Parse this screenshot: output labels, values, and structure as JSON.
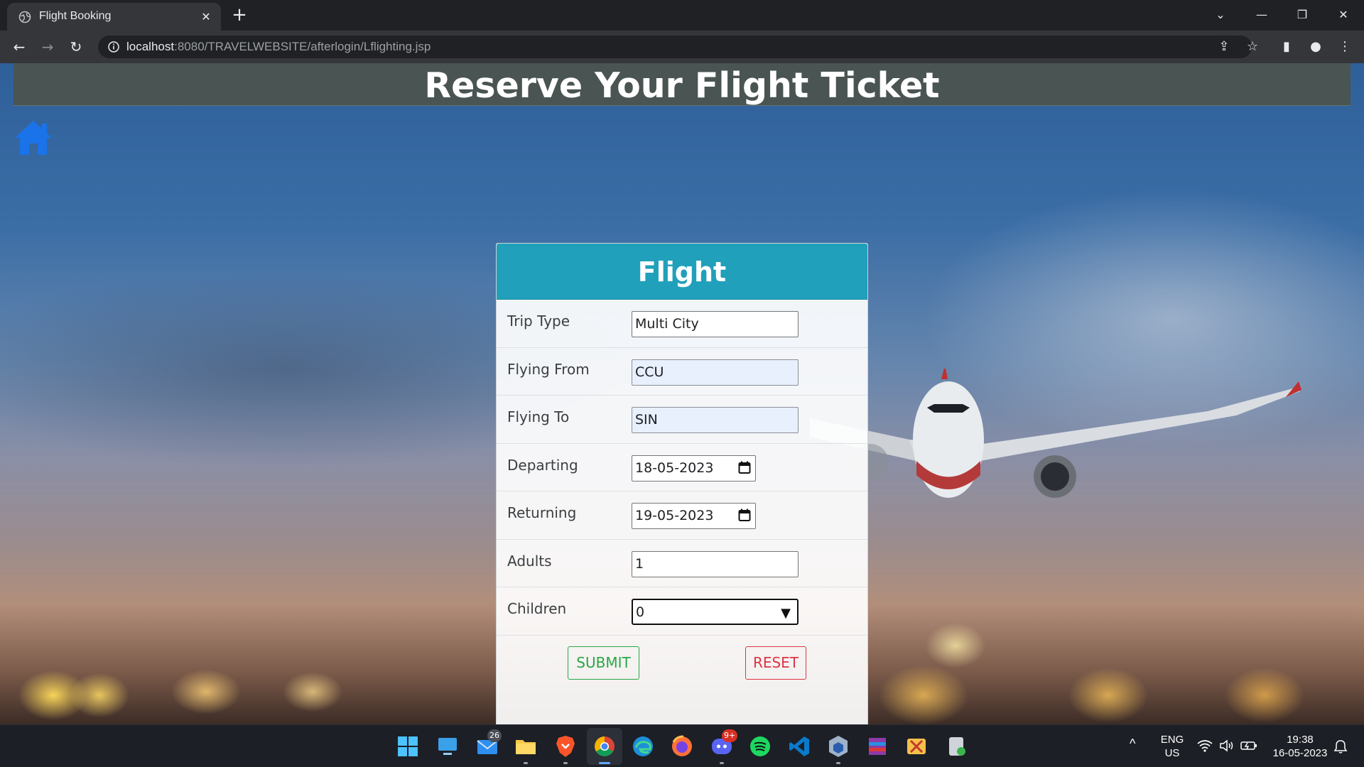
{
  "browser": {
    "tab_title": "Flight Booking",
    "url_host": "localhost",
    "url_path": ":8080/TRAVELWEBSITE/afterlogin/Lflighting.jsp"
  },
  "page": {
    "heading": "Reserve Your Flight Ticket",
    "form": {
      "title": "Flight",
      "fields": [
        {
          "label": "Trip Type",
          "value": "Multi City"
        },
        {
          "label": "Flying From",
          "value": "CCU"
        },
        {
          "label": "Flying To",
          "value": "SIN"
        },
        {
          "label": "Departing",
          "value": "18-05-2023"
        },
        {
          "label": "Returning",
          "value": "19-05-2023"
        },
        {
          "label": "Adults",
          "value": "1"
        },
        {
          "label": "Children",
          "value": "0"
        }
      ],
      "submit_label": "SUBMIT",
      "reset_label": "RESET"
    }
  },
  "taskbar": {
    "mail_badge": "26",
    "discord_badge": "9+",
    "lang_top": "ENG",
    "lang_bottom": "US",
    "time": "19:38",
    "date": "16-05-2023"
  },
  "colors": {
    "card_header": "#20a0bb",
    "submit": "#28a745",
    "reset": "#dc3545",
    "home_icon": "#1a73e8"
  }
}
